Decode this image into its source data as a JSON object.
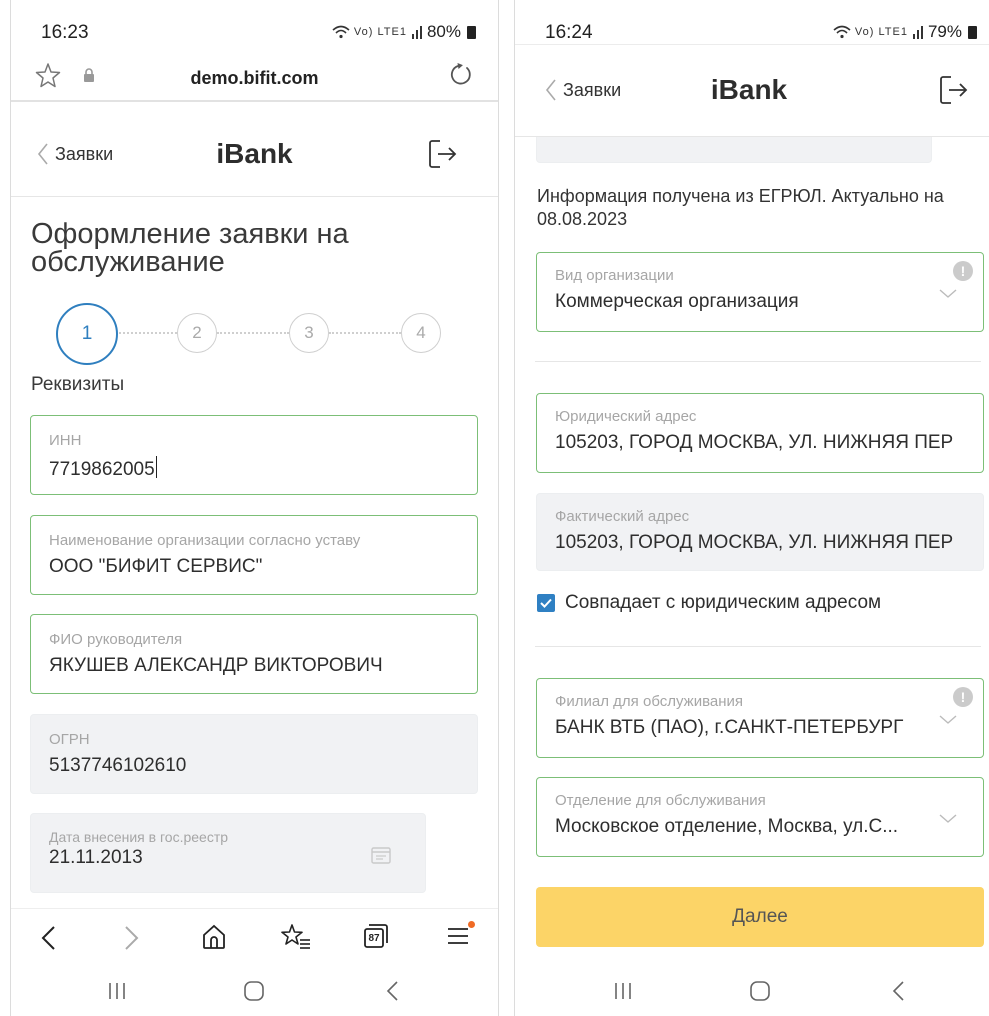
{
  "left": {
    "status": {
      "time": "16:23",
      "battery": "80%",
      "network_icons": "Vo) LTE1"
    },
    "browser": {
      "url": "demo.bifit.com"
    },
    "header": {
      "back_label": "Заявки",
      "app_title": "iBank"
    },
    "page_title": "Оформление заявки на обслуживание",
    "stepper": {
      "steps": [
        "1",
        "2",
        "3",
        "4"
      ],
      "active_step": 1
    },
    "section_title": "Реквизиты",
    "fields": {
      "inn": {
        "label": "ИНН",
        "value": "7719862005"
      },
      "org_name": {
        "label": "Наименование организации согласно уставу",
        "value": "ООО \"БИФИТ СЕРВИС\""
      },
      "director": {
        "label": "ФИО руководителя",
        "value": "ЯКУШЕВ АЛЕКСАНДР ВИКТОРОВИЧ"
      },
      "ogrn": {
        "label": "ОГРН",
        "value": "5137746102610"
      },
      "reg_date": {
        "label": "Дата внесения в гос.реестр",
        "value": "21.11.2013"
      }
    },
    "browser_nav": {
      "tabs_count": "87"
    }
  },
  "right": {
    "status": {
      "time": "16:24",
      "battery": "79%",
      "network_icons": "Vo) LTE1"
    },
    "header": {
      "back_label": "Заявки",
      "app_title": "iBank"
    },
    "info_text": "Информация получена из ЕГРЮЛ. Актуально на 08.08.2023",
    "fields": {
      "org_type": {
        "label": "Вид организации",
        "value": "Коммерческая организация"
      },
      "legal_address": {
        "label": "Юридический адрес",
        "value": "105203, ГОРОД МОСКВА, УЛ. НИЖНЯЯ ПЕР"
      },
      "actual_address": {
        "label": "Фактический адрес",
        "value": "105203, ГОРОД МОСКВА, УЛ. НИЖНЯЯ ПЕР"
      },
      "branch": {
        "label": "Филиал для обслуживания",
        "value": "БАНК ВТБ (ПАО), г.САНКТ-ПЕТЕРБУРГ"
      },
      "office": {
        "label": "Отделение для обслуживания",
        "value": "Московское отделение, Москва, ул.С..."
      }
    },
    "same_address": {
      "label": "Совпадает с юридическим адресом",
      "checked": true
    },
    "next_button": "Далее"
  },
  "colors": {
    "accent_blue": "#2f7fbf",
    "field_border_green": "#7cbf77",
    "button_yellow": "#fcd467",
    "readonly_bg": "#f1f2f4",
    "notification_dot": "#f06b25"
  },
  "icons": {
    "left": [
      "bookmark-star-icon",
      "lock-icon",
      "reload-icon",
      "chevron-left-icon",
      "logout-icon",
      "calendar-icon",
      "back-arrow-icon",
      "forward-arrow-icon",
      "home-icon",
      "bookmarks-icon",
      "tabs-icon",
      "menu-icon"
    ],
    "right": [
      "chevron-left-icon",
      "logout-icon",
      "info-icon",
      "chevron-down-icon",
      "checkbox-checked-icon"
    ],
    "system": [
      "recent-apps-icon",
      "home-circle-icon",
      "system-back-icon"
    ]
  }
}
